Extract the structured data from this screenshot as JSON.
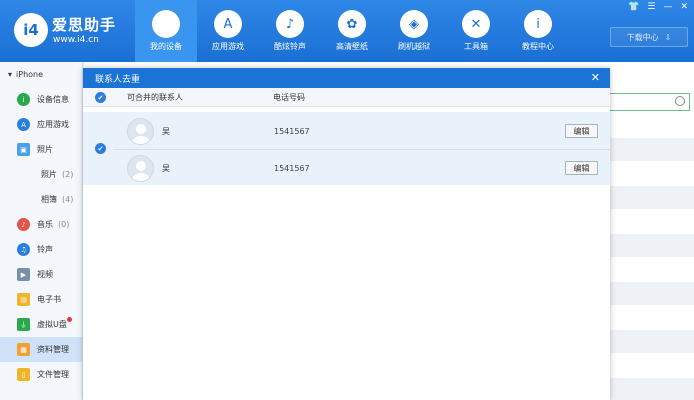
{
  "app": {
    "name": "爱思助手",
    "url": "www.i4.cn",
    "logo_text": "i4"
  },
  "nav": [
    {
      "label": "我的设备",
      "icon": "apple-icon",
      "glyph": "",
      "active": true
    },
    {
      "label": "应用游戏",
      "icon": "appstore-icon",
      "glyph": "A"
    },
    {
      "label": "酷炫铃声",
      "icon": "bell-icon",
      "glyph": "♪"
    },
    {
      "label": "高清壁纸",
      "icon": "flower-icon",
      "glyph": "✿"
    },
    {
      "label": "刷机越狱",
      "icon": "dropbox-icon",
      "glyph": "◈"
    },
    {
      "label": "工具箱",
      "icon": "tools-icon",
      "glyph": "✕"
    },
    {
      "label": "教程中心",
      "icon": "info-icon",
      "glyph": "i"
    }
  ],
  "window": {
    "skin": "👕",
    "menu": "☰",
    "minimize": "—",
    "close": "✕"
  },
  "download": {
    "label": "下载中心",
    "icon": "⇩"
  },
  "sidebar": {
    "device": "iPhone",
    "items": [
      {
        "label": "设备信息",
        "icon": "info-icon",
        "color": "#2aa84a",
        "glyph": "i"
      },
      {
        "label": "应用游戏",
        "icon": "appstore-icon",
        "color": "#2a7fde",
        "glyph": "A"
      },
      {
        "label": "照片",
        "icon": "photo-icon",
        "color": "#4aa0e6",
        "glyph": "▣"
      },
      {
        "label": "照片",
        "count": "(2)",
        "sub": true
      },
      {
        "label": "相簿",
        "count": "(4)",
        "sub": true
      },
      {
        "label": "音乐",
        "count": "(0)",
        "icon": "music-icon",
        "color": "#e5534b",
        "glyph": "♪"
      },
      {
        "label": "铃声",
        "icon": "bell-icon",
        "color": "#2a7fde",
        "glyph": "♫"
      },
      {
        "label": "视频",
        "icon": "video-icon",
        "color": "#7a8fa8",
        "glyph": "▶"
      },
      {
        "label": "电子书",
        "icon": "book-icon",
        "color": "#f0b429",
        "glyph": "▤"
      },
      {
        "label": "虚拟U盘",
        "icon": "usb-icon",
        "color": "#2aa84a",
        "glyph": "⏚",
        "badge": true
      },
      {
        "label": "资料管理",
        "icon": "contacts-icon",
        "color": "#f0a030",
        "glyph": "▦",
        "active": true
      },
      {
        "label": "文件管理",
        "icon": "file-icon",
        "color": "#f0b429",
        "glyph": "▯"
      }
    ]
  },
  "dialog": {
    "title": "联系人去重",
    "close": "✕",
    "columns": {
      "mergeable": "可合并的联系人",
      "phone": "电话号码"
    },
    "check": "✔",
    "rows": [
      {
        "name": "吴",
        "phone": "1541567",
        "edit": "编辑"
      },
      {
        "name": "吴",
        "phone": "1541567",
        "edit": "编辑"
      }
    ]
  }
}
